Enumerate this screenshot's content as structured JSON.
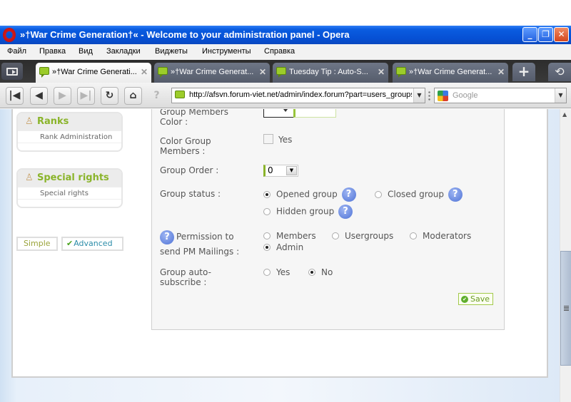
{
  "window": {
    "title": "»†War Crime Generation†« - Welcome to your administration panel - Opera",
    "minimize": "_",
    "restore": "❐",
    "close": "✕"
  },
  "menu": [
    "Файл",
    "Правка",
    "Вид",
    "Закладки",
    "Виджеты",
    "Инструменты",
    "Справка"
  ],
  "tabs": [
    {
      "label": "»†War Crime Generati...",
      "active": true
    },
    {
      "label": "»†War Crime Generat...",
      "active": false
    },
    {
      "label": "Tuesday Tip : Auto-S...",
      "active": false
    },
    {
      "label": "»†War Crime Generat...",
      "active": false
    }
  ],
  "tab_close": "✕",
  "new_tab": "+",
  "closed_tabs": "⟲",
  "nav": {
    "rewind": "|◀",
    "back": "◀",
    "forward": "▶",
    "fastforward": "▶|",
    "reload": "↻",
    "home": "⌂",
    "wand": "?",
    "url": "http://afsvn.forum-viet.net/admin/index.forum?part=users_groups",
    "search_placeholder": "Google",
    "dropdown": "▼"
  },
  "sidebar": {
    "boxes": [
      {
        "title": "Ranks",
        "icon": "♙",
        "items": [
          "Rank Administration"
        ]
      },
      {
        "title": "Special rights",
        "icon": "♙",
        "items": [
          "Special rights"
        ]
      }
    ],
    "mode_simple": "Simple",
    "mode_advanced": "Advanced",
    "mode_check": "✔"
  },
  "form": {
    "members_color_label": "Group Members Color :",
    "color_group_label": "Color Group Members :",
    "color_group_option": "Yes",
    "color_group_checked": false,
    "group_order_label": "Group Order :",
    "group_order_value": "0",
    "group_status_label": "Group status :",
    "group_status_options": [
      {
        "label": "Opened group",
        "checked": true
      },
      {
        "label": "Closed group",
        "checked": false
      },
      {
        "label": "Hidden group",
        "checked": false
      }
    ],
    "pm_label": "Permission to send PM Mailings :",
    "pm_options": [
      {
        "label": "Members",
        "checked": false
      },
      {
        "label": "Usergroups",
        "checked": false
      },
      {
        "label": "Moderators",
        "checked": false
      },
      {
        "label": "Admin",
        "checked": true
      }
    ],
    "auto_sub_label": "Group auto-subscribe :",
    "auto_sub_options": [
      {
        "label": "Yes",
        "checked": false
      },
      {
        "label": "No",
        "checked": true
      }
    ],
    "help": "?",
    "save_label": "Save",
    "save_icon": "✔"
  },
  "colors": {
    "accent_green": "#8ab42a",
    "help_blue": "#4f73d6",
    "titlebar_blue": "#0650d4"
  }
}
